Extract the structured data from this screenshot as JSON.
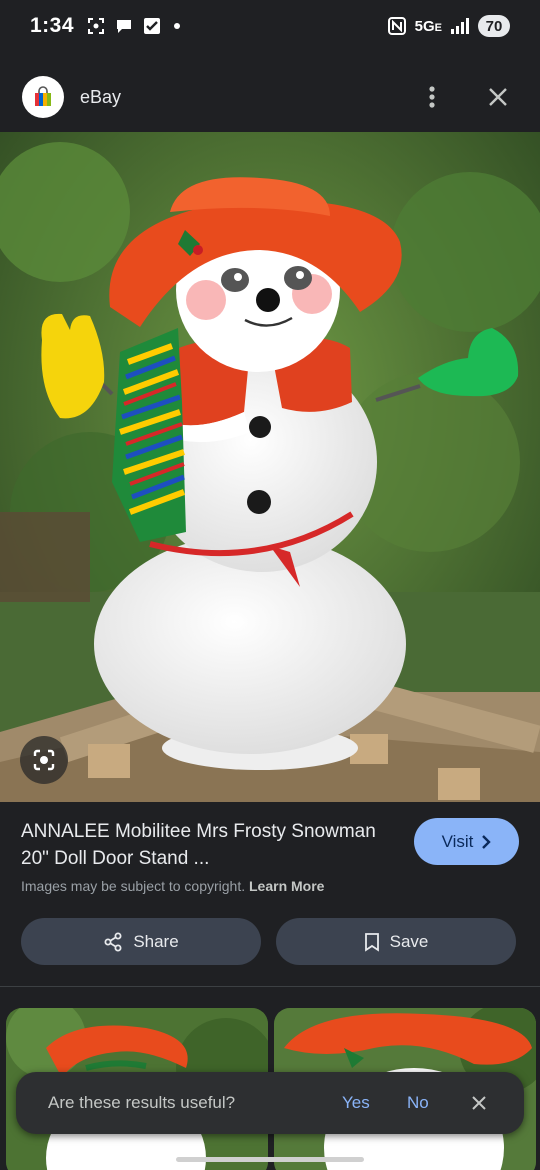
{
  "status_bar": {
    "time": "1:34",
    "network": "5G",
    "network_suffix": "E",
    "battery": "70",
    "icons": [
      "screenshot-icon",
      "chat-bubble-icon",
      "checkbox-icon",
      "nfc-icon",
      "signal-icon"
    ]
  },
  "header": {
    "site_name": "eBay",
    "icons": [
      "ebay-bag-icon",
      "more-vert-icon",
      "close-icon"
    ]
  },
  "result": {
    "title": "ANNALEE Mobilitee Mrs Frosty Snowman 20\" Doll Door Stand ...",
    "visit_label": "Visit",
    "copyright_text": "Images may be subject to copyright.",
    "learn_more": "Learn More",
    "share_label": "Share",
    "save_label": "Save"
  },
  "feedback": {
    "question": "Are these results useful?",
    "yes": "Yes",
    "no": "No"
  },
  "colors": {
    "background": "#1f2023",
    "accent_blue": "#8ab4f8",
    "button_bg": "#3c4350",
    "snackbar_bg": "#2d2f31"
  }
}
